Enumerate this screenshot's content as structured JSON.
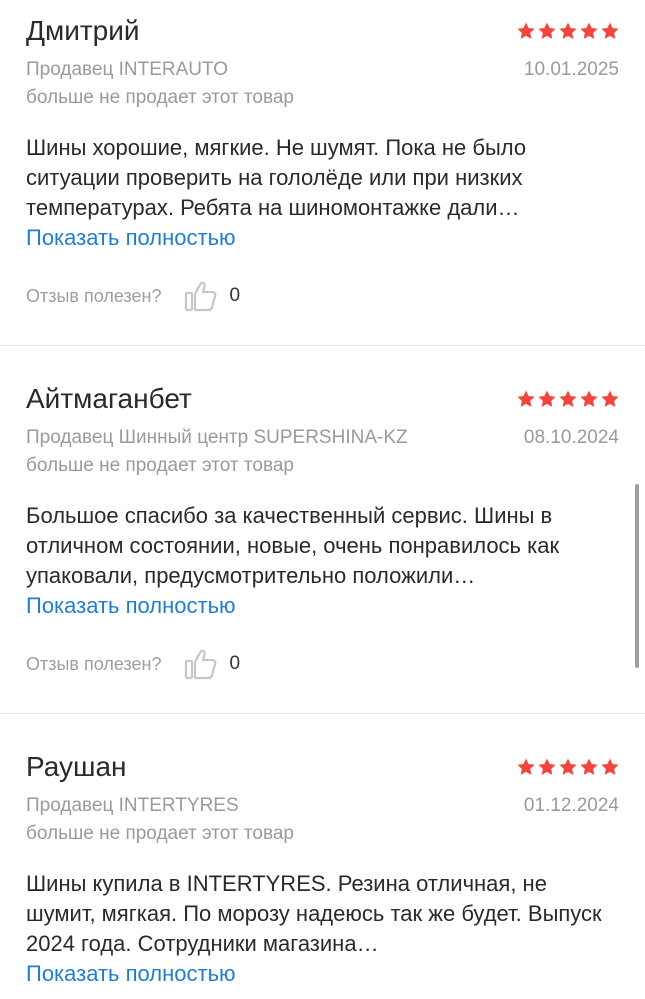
{
  "reviews": [
    {
      "author": "Дмитрий",
      "rating": 5,
      "seller": "Продавец INTERAUTO",
      "date": "10.01.2025",
      "seller_status": "больше не продает этот товар",
      "text": "Шины хорошие, мягкие. Не шумят. Пока не было ситуации проверить на гололёде или при низких температурах. Ребята на шиномонтажке дали…",
      "show_more": "Показать полностью",
      "helpful_label": "Отзыв полезен?",
      "helpful_count": "0"
    },
    {
      "author": "Айтмаганбет",
      "rating": 5,
      "seller": "Продавец Шинный центр SUPERSHINA-KZ",
      "date": "08.10.2024",
      "seller_status": "больше не продает этот товар",
      "text": "Большое спасибо за качественный сервис. Шины в отличном состоянии, новые, очень понравилось как упаковали, предусмотрительно положили…",
      "show_more": "Показать полностью",
      "helpful_label": "Отзыв полезен?",
      "helpful_count": "0"
    },
    {
      "author": "Раушан",
      "rating": 5,
      "seller": "Продавец INTERTYRES",
      "date": "01.12.2024",
      "seller_status": "больше не продает этот товар",
      "text": "Шины купила в INTERTYRES. Резина отличная, не шумит, мягкая. По морозу надеюсь так же будет. Выпуск 2024 года. Сотрудники магазина…",
      "show_more": "Показать полностью"
    }
  ],
  "colors": {
    "star": "#f1453d",
    "link": "#1f7fcf",
    "muted": "#9a9a9a"
  },
  "icons": {
    "star": "star-icon",
    "thumb": "thumbs-up-icon"
  }
}
